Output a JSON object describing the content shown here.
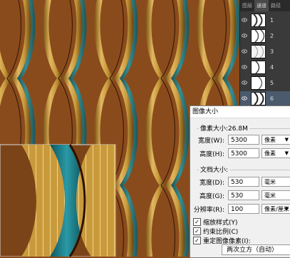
{
  "panel": {
    "tabs": [
      "图层",
      "通道",
      "路径"
    ],
    "channels": [
      "1",
      "2",
      "3",
      "4",
      "5",
      "6"
    ],
    "selected_channel": "6"
  },
  "dialog": {
    "title": "图像大小",
    "pixel_size_label": "像素大小:26.8M",
    "width_label": "宽度(W):",
    "width_value": "5300",
    "width_unit": "像素",
    "height_label": "高度(H):",
    "height_value": "5300",
    "height_unit": "像素",
    "doc_size_label": "文档大小:",
    "doc_width_label": "宽度(D):",
    "doc_width_value": "530",
    "doc_width_unit": "毫米",
    "doc_height_label": "高度(G):",
    "doc_height_value": "530",
    "doc_height_unit": "毫米",
    "resolution_label": "分辨率(R):",
    "resolution_value": "100",
    "resolution_unit": "像素/厘米",
    "scale_styles": "缩放样式(Y)",
    "constrain": "约束比例(C)",
    "resample": "重定图像像素(I):",
    "resample_method": "两次立方（自动）"
  },
  "colors": {
    "background": "#8a4b1c",
    "gold": "#c99a3c",
    "gold_dark": "#7a5312",
    "teal": "#1f7f8a",
    "panel_bg": "#3a3a3a",
    "dialog_bg": "#f0f0f0"
  }
}
